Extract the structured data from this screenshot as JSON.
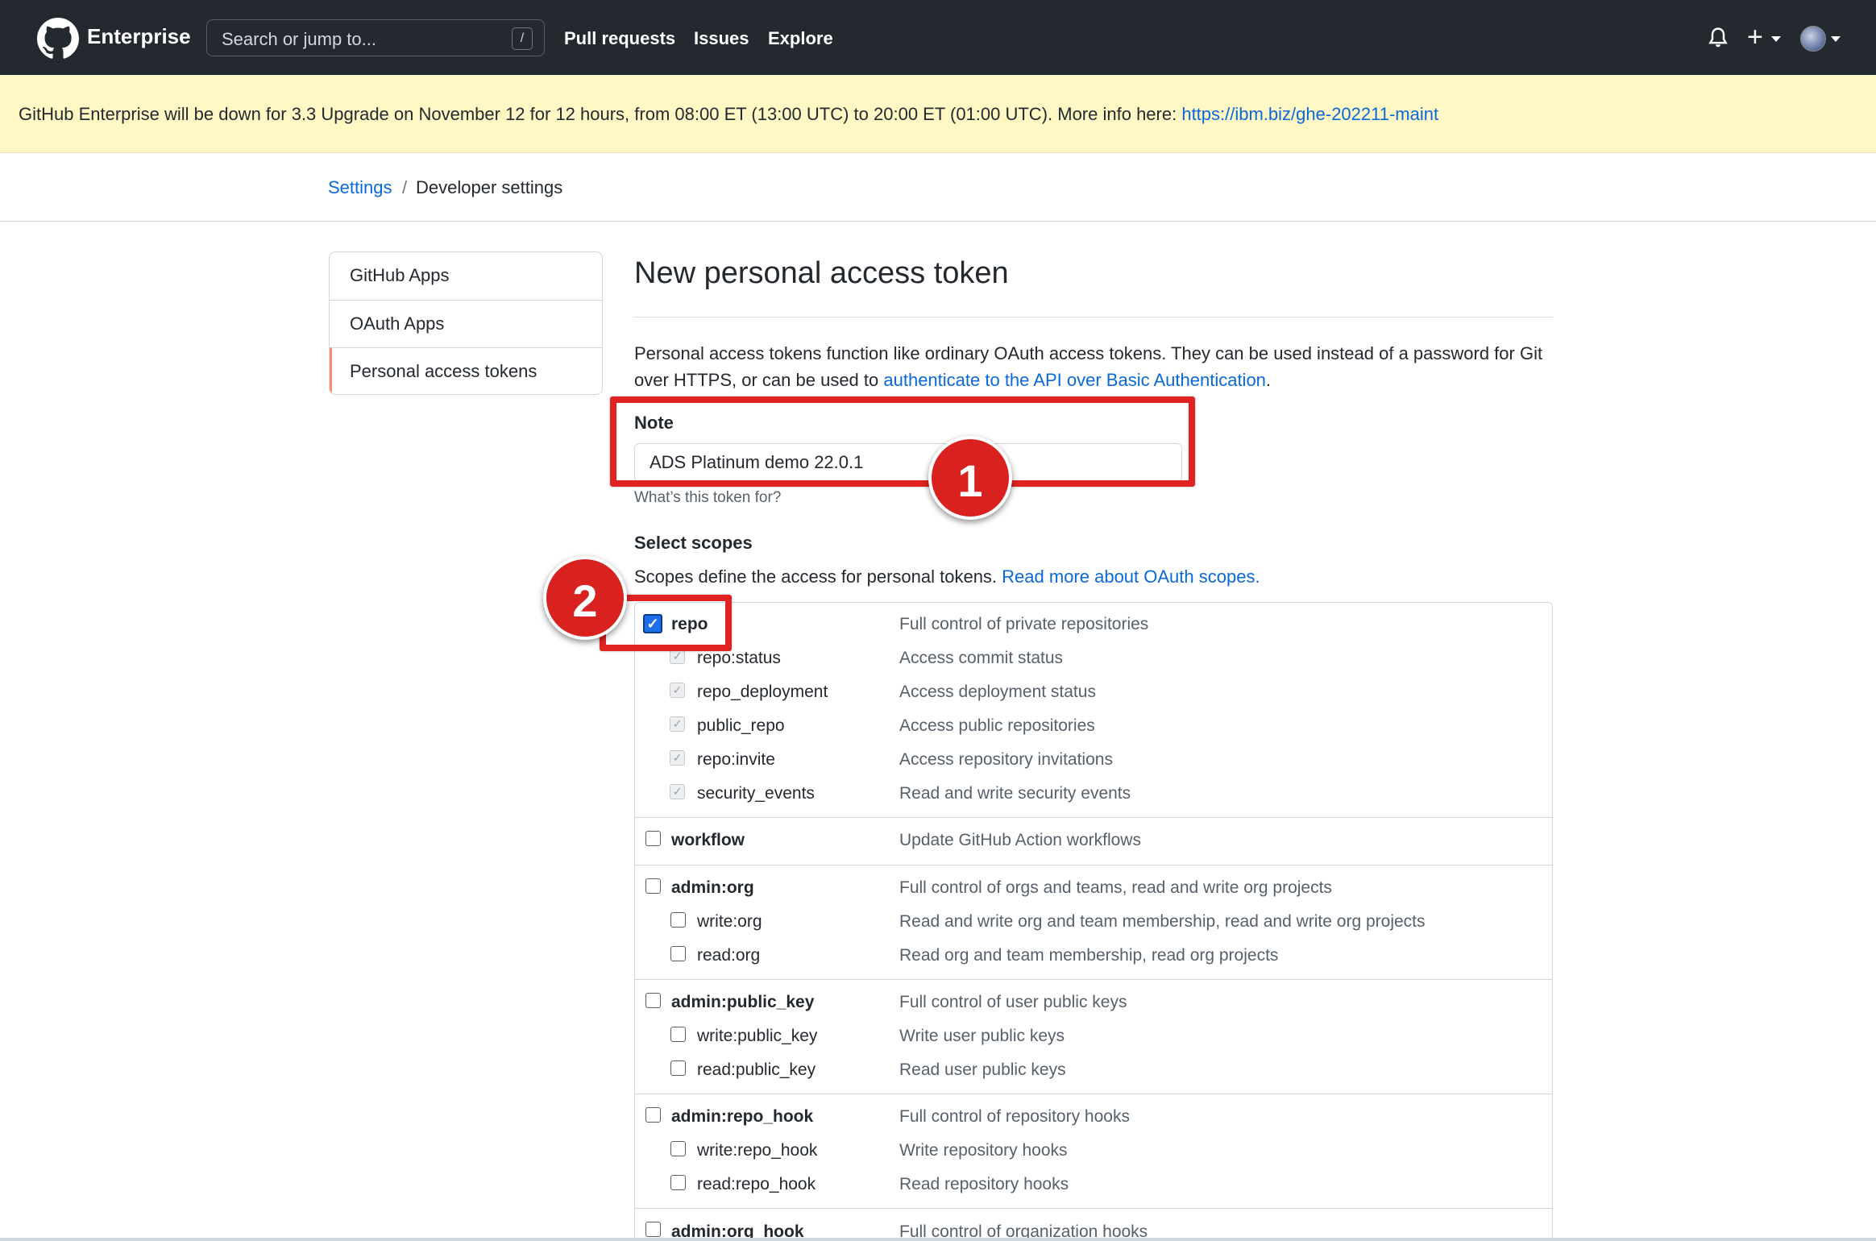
{
  "header": {
    "brand": "Enterprise",
    "search_placeholder": "Search or jump to...",
    "search_key": "/",
    "nav": [
      "Pull requests",
      "Issues",
      "Explore"
    ]
  },
  "banner": {
    "text": "GitHub Enterprise will be down for 3.3 Upgrade on November 12 for 12 hours, from 08:00 ET (13:00 UTC) to 20:00 ET (01:00 UTC). More info here: ",
    "link": "https://ibm.biz/ghe-202211-maint"
  },
  "breadcrumb": {
    "settings": "Settings",
    "separator": "/",
    "current": "Developer settings"
  },
  "sidebar": {
    "items": [
      "GitHub Apps",
      "OAuth Apps",
      "Personal access tokens"
    ],
    "active_index": 2
  },
  "page": {
    "title": "New personal access token",
    "desc_text": "Personal access tokens function like ordinary OAuth access tokens. They can be used instead of a password for Git over HTTPS, or can be used to ",
    "desc_link": "authenticate to the API over Basic Authentication",
    "desc_end": "."
  },
  "note": {
    "label": "Note",
    "value": "ADS Platinum demo 22.0.1",
    "hint": "What’s this token for?"
  },
  "scopes": {
    "label": "Select scopes",
    "desc_text": "Scopes define the access for personal tokens. ",
    "desc_link": "Read more about OAuth scopes.",
    "items": [
      {
        "name": "repo",
        "desc": "Full control of private repositories",
        "checked": true
      },
      {
        "name": "repo:status",
        "desc": "Access commit status",
        "checked": true
      },
      {
        "name": "repo_deployment",
        "desc": "Access deployment status",
        "checked": true
      },
      {
        "name": "public_repo",
        "desc": "Access public repositories",
        "checked": true
      },
      {
        "name": "repo:invite",
        "desc": "Access repository invitations",
        "checked": true
      },
      {
        "name": "security_events",
        "desc": "Read and write security events",
        "checked": true
      },
      {
        "name": "workflow",
        "desc": "Update GitHub Action workflows",
        "checked": false
      },
      {
        "name": "admin:org",
        "desc": "Full control of orgs and teams, read and write org projects",
        "checked": false
      },
      {
        "name": "write:org",
        "desc": "Read and write org and team membership, read and write org projects",
        "checked": false
      },
      {
        "name": "read:org",
        "desc": "Read org and team membership, read org projects",
        "checked": false
      },
      {
        "name": "admin:public_key",
        "desc": "Full control of user public keys",
        "checked": false
      },
      {
        "name": "write:public_key",
        "desc": "Write user public keys",
        "checked": false
      },
      {
        "name": "read:public_key",
        "desc": "Read user public keys",
        "checked": false
      },
      {
        "name": "admin:repo_hook",
        "desc": "Full control of repository hooks",
        "checked": false
      },
      {
        "name": "write:repo_hook",
        "desc": "Write repository hooks",
        "checked": false
      },
      {
        "name": "read:repo_hook",
        "desc": "Read repository hooks",
        "checked": false
      },
      {
        "name": "admin:org_hook",
        "desc": "Full control of organization hooks",
        "checked": false
      }
    ]
  },
  "annotations": {
    "step1": "1",
    "step2": "2",
    "color": "#e02222"
  }
}
